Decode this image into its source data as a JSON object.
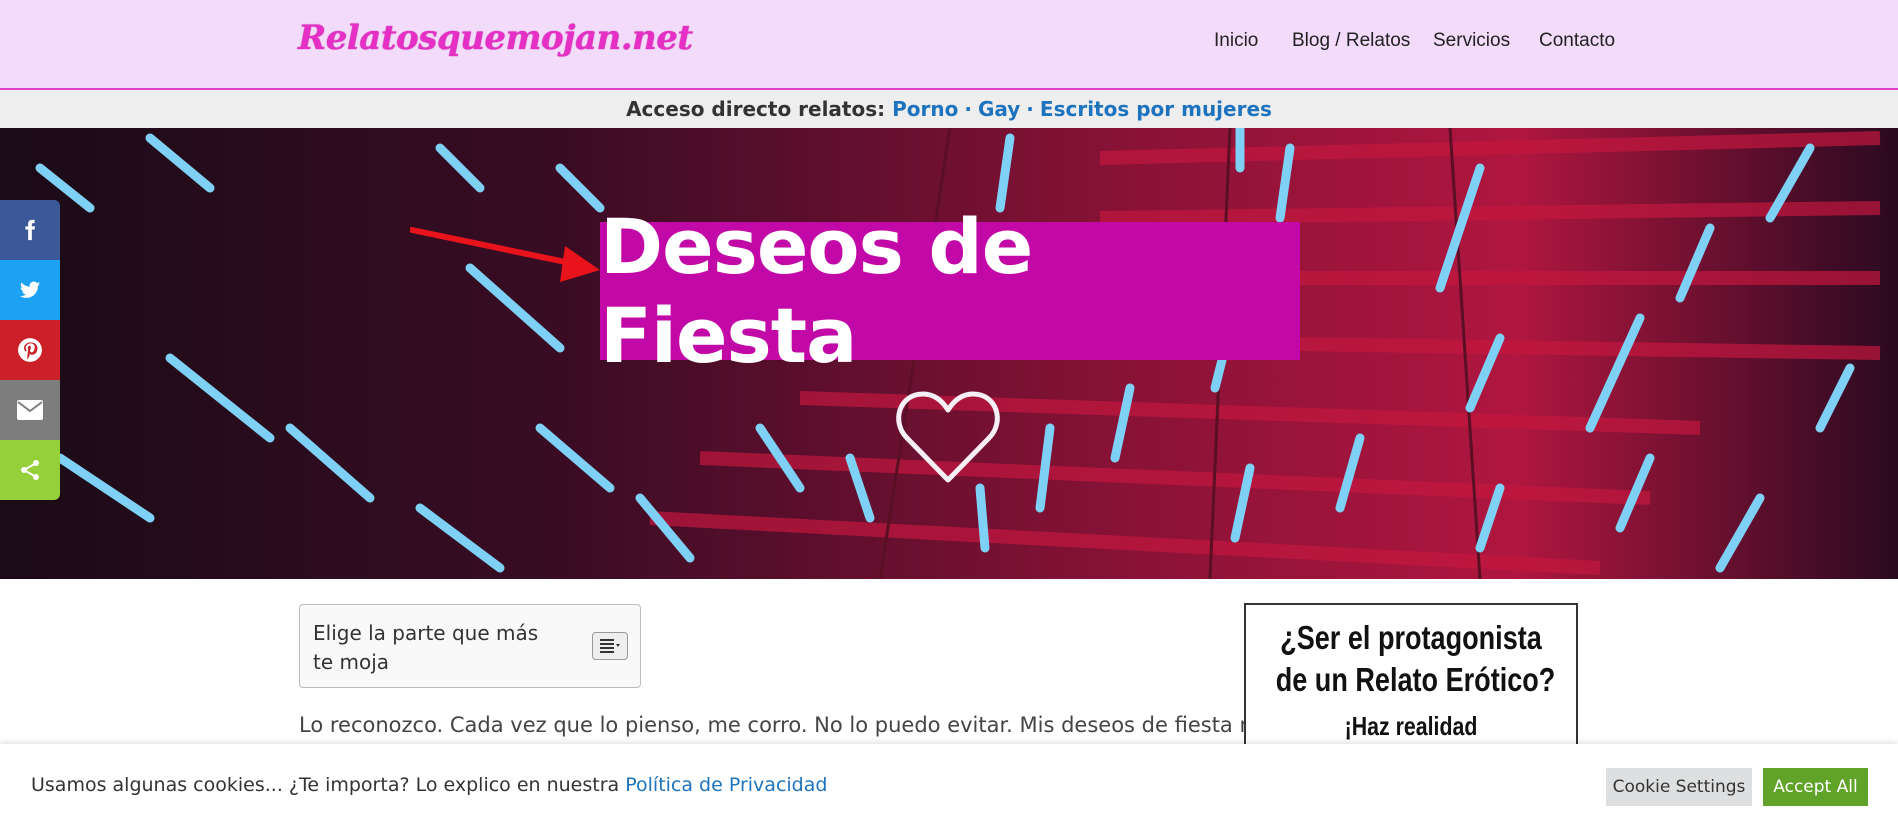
{
  "header": {
    "logo_text": "Relatosquemojan.net",
    "nav": [
      {
        "label": "Inicio"
      },
      {
        "label": "Blog / Relatos"
      },
      {
        "label": "Servicios"
      },
      {
        "label": "Contacto"
      }
    ]
  },
  "quick_access": {
    "prefix": "Acceso directo relatos:",
    "links": [
      "Porno",
      "Gay",
      "Escritos por mujeres"
    ],
    "separator": "·"
  },
  "hero": {
    "title": "Deseos de Fiesta",
    "title_bg_color": "#c208a6"
  },
  "share_bar": [
    {
      "icon": "facebook-icon",
      "color": "#3b5998"
    },
    {
      "icon": "twitter-icon",
      "color": "#1da1f2"
    },
    {
      "icon": "pinterest-icon",
      "color": "#cb2027"
    },
    {
      "icon": "email-icon",
      "color": "#7d7d7d"
    },
    {
      "icon": "share-icon",
      "color": "#95d03a"
    }
  ],
  "toc": {
    "title": "Elige la parte que más te moja"
  },
  "article": {
    "intro": "Lo reconozco. Cada vez que lo pienso, me corro. No lo puedo evitar. Mis deseos de fiesta me"
  },
  "ad": {
    "line1": "¿Ser el protagonista",
    "line2": "de un Relato Erótico?",
    "line3": "¡Haz realidad"
  },
  "cookie": {
    "text": "Usamos algunas cookies... ¿Te importa? Lo explico en nuestra",
    "link": "Política de Privacidad",
    "settings_label": "Cookie Settings",
    "accept_label": "Accept All"
  },
  "colors": {
    "header_bg": "#f3dbfb",
    "logo": "#e62fc4",
    "link": "#1e73be",
    "accept": "#61a229"
  }
}
